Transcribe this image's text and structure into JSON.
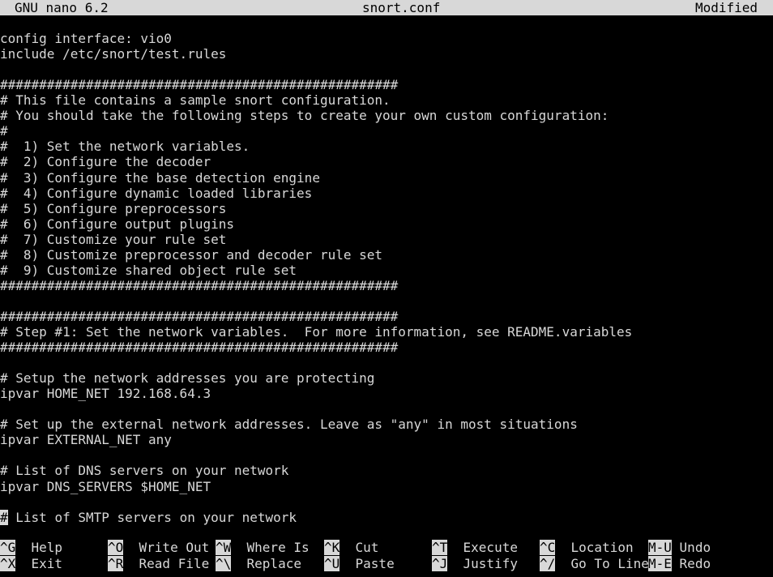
{
  "titlebar": {
    "app": "GNU nano 6.2",
    "filename": "snort.conf",
    "status": "Modified"
  },
  "editor": {
    "lines": [
      "",
      "config interface: vio0",
      "include /etc/snort/test.rules",
      "",
      "###################################################",
      "# This file contains a sample snort configuration.",
      "# You should take the following steps to create your own custom configuration:",
      "#",
      "#  1) Set the network variables.",
      "#  2) Configure the decoder",
      "#  3) Configure the base detection engine",
      "#  4) Configure dynamic loaded libraries",
      "#  5) Configure preprocessors",
      "#  6) Configure output plugins",
      "#  7) Customize your rule set",
      "#  8) Customize preprocessor and decoder rule set",
      "#  9) Customize shared object rule set",
      "###################################################",
      "",
      "###################################################",
      "# Step #1: Set the network variables.  For more information, see README.variables",
      "###################################################",
      "",
      "# Setup the network addresses you are protecting",
      "ipvar HOME_NET 192.168.64.3",
      "",
      "# Set up the external network addresses. Leave as \"any\" in most situations",
      "ipvar EXTERNAL_NET any",
      "",
      "# List of DNS servers on your network",
      "ipvar DNS_SERVERS $HOME_NET",
      "",
      "# List of SMTP servers on your network"
    ],
    "cursor_line_index": 32
  },
  "help": [
    {
      "key": "^G",
      "label": "Help"
    },
    {
      "key": "^X",
      "label": "Exit"
    },
    {
      "key": "^O",
      "label": "Write Out"
    },
    {
      "key": "^R",
      "label": "Read File"
    },
    {
      "key": "^W",
      "label": "Where Is"
    },
    {
      "key": "^\\",
      "label": "Replace"
    },
    {
      "key": "^K",
      "label": "Cut"
    },
    {
      "key": "^U",
      "label": "Paste"
    },
    {
      "key": "^T",
      "label": "Execute"
    },
    {
      "key": "^J",
      "label": "Justify"
    },
    {
      "key": "^C",
      "label": "Location"
    },
    {
      "key": "^/",
      "label": "Go To Line"
    },
    {
      "key": "M-U",
      "label": "Undo"
    },
    {
      "key": "M-E",
      "label": "Redo"
    }
  ],
  "colors": {
    "background": "#000000",
    "foreground": "#d8d8d8",
    "inverse_bg": "#d8d8d8",
    "inverse_fg": "#000000"
  }
}
